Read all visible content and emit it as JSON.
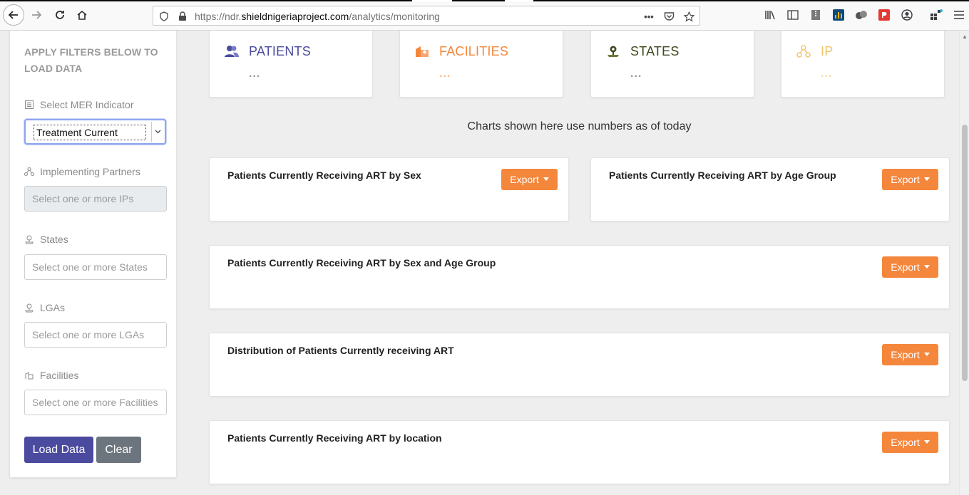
{
  "browser": {
    "url_prefix": "https://ndr.",
    "url_domain": "shieldnigeriaproject.com",
    "url_path": "/analytics/monitoring",
    "more_icon": "•••"
  },
  "sidebar": {
    "title": "APPLY FILTERS BELOW TO LOAD DATA",
    "mer_label": "Select MER Indicator",
    "mer_value": "Treatment Current",
    "ip_label": "Implementing Partners",
    "ip_placeholder": "Select one or more IPs",
    "states_label": "States",
    "states_placeholder": "Select one or more States",
    "lgas_label": "LGAs",
    "lgas_placeholder": "Select one or more LGAs",
    "facilities_label": "Facilities",
    "facilities_placeholder": "Select one or more Facilities",
    "load_label": "Load Data",
    "clear_label": "Clear"
  },
  "stats": [
    {
      "label": "PATIENTS",
      "value": "...",
      "color": "#4a4a9f"
    },
    {
      "label": "FACILITIES",
      "value": "...",
      "color": "#f5873d"
    },
    {
      "label": "STATES",
      "value": "...",
      "color": "#3d4a1f"
    },
    {
      "label": "IP",
      "value": "...",
      "color": "#f2c46a"
    }
  ],
  "note": "Charts shown here use numbers as of today",
  "panels": [
    {
      "title": "Patients Currently Receiving ART by Sex",
      "export": "Export"
    },
    {
      "title": "Patients Currently Receiving ART by Age Group",
      "export": "Export"
    },
    {
      "title": "Patients Currently Receiving ART by Sex and Age Group",
      "export": "Export"
    },
    {
      "title": "Distribution of Patients Currently receiving ART",
      "export": "Export"
    },
    {
      "title": "Patients Currently Receiving ART by location",
      "export": "Export"
    }
  ]
}
